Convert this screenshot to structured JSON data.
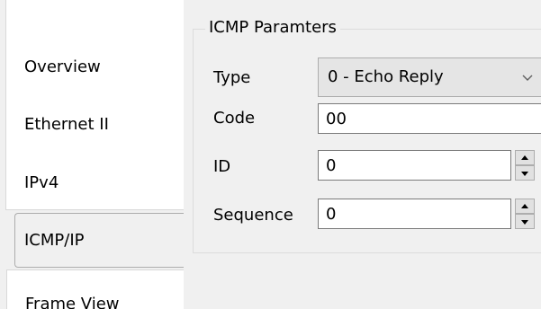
{
  "tabs": {
    "overview": "Overview",
    "ethernet": "Ethernet II",
    "ipv4": "IPv4",
    "icmp": "ICMP/IP",
    "frame": "Frame View"
  },
  "group": {
    "title": "ICMP Paramters"
  },
  "fields": {
    "type_label": "Type",
    "type_value": "0 - Echo Reply",
    "code_label": "Code",
    "code_value": "00",
    "id_label": "ID",
    "id_value": "0",
    "sequence_label": "Sequence",
    "sequence_value": "0"
  },
  "icons": {
    "type_dropdown": "chevron-down-icon",
    "spin_up": "spin-up-icon",
    "spin_down": "spin-down-icon"
  }
}
